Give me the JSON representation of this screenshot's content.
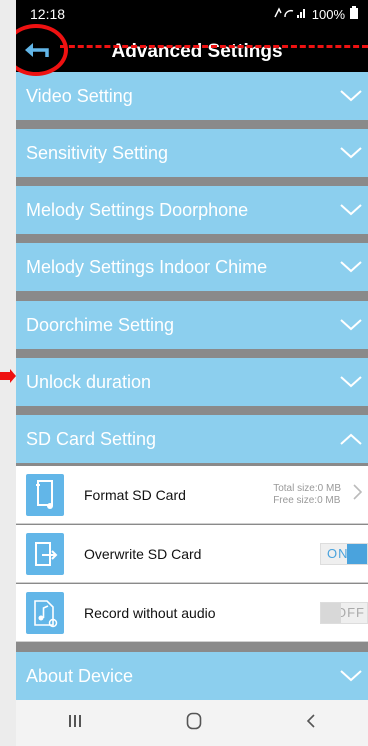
{
  "status_bar": {
    "time": "12:18",
    "battery": "100%"
  },
  "header": {
    "title": "Advanced Settings"
  },
  "sections": [
    {
      "label": "Video Setting"
    },
    {
      "label": "Sensitivity Setting"
    },
    {
      "label": "Melody Settings Doorphone"
    },
    {
      "label": "Melody Settings Indoor Chime"
    },
    {
      "label": "Doorchime Setting"
    },
    {
      "label": "Unlock duration"
    },
    {
      "label": "SD Card Setting"
    },
    {
      "label": "About Device"
    }
  ],
  "sd_card": {
    "format": {
      "label": "Format SD Card",
      "total": "Total size:0 MB",
      "free": "Free size:0 MB"
    },
    "overwrite": {
      "label": "Overwrite SD Card",
      "toggle": "ON"
    },
    "record_audio": {
      "label": "Record without audio",
      "toggle": "OFF"
    }
  },
  "colors": {
    "section_bg": "#8ccfee",
    "accent": "#4aa3dd",
    "annotation": "#ee1111"
  },
  "icons": [
    "back-arrow-icon",
    "chevron-down-icon",
    "chevron-up-icon",
    "sd-card-icon",
    "overwrite-icon",
    "music-note-icon",
    "recent-apps-icon",
    "home-icon",
    "back-nav-icon"
  ]
}
